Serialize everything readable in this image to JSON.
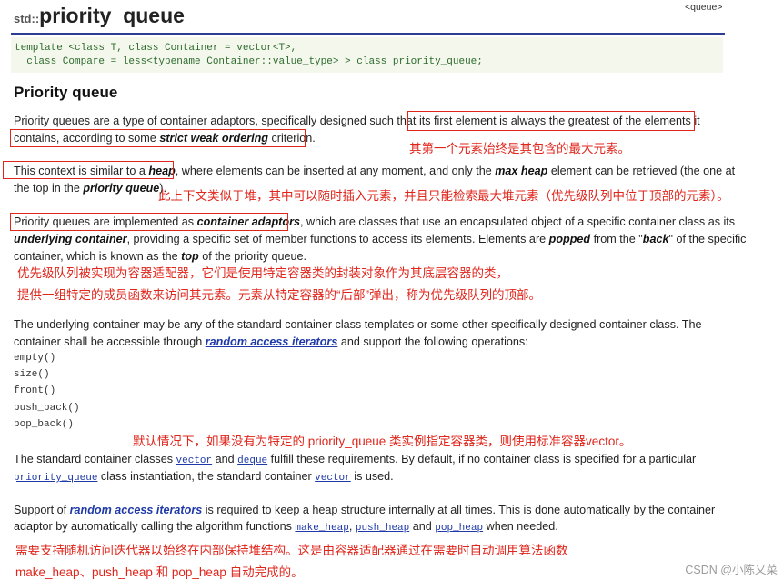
{
  "title": {
    "namespace": "std::",
    "name": "priority_queue"
  },
  "header_tag": "<queue>",
  "declaration": {
    "line1": "template <class T, class Container = vector<T>,",
    "line2": "  class Compare = less<typename Container::value_type> > class priority_queue;"
  },
  "heading": "Priority queue",
  "p1": {
    "l1_a": "Priority queues are a type of container adaptors, specifically designed such that ",
    "l1_b": "its first element is always the greatest of the elements it",
    "l2_a": "contains, according to some ",
    "l2_b": "strict weak ordering",
    "l2_c": " criterion."
  },
  "ann1": "其第一个元素始终是其包含的最大元素。",
  "p2": {
    "l1_a": "This context is similar to a ",
    "l1_b": "heap",
    "l1_c": ", where elements can be inserted at any moment, and only the ",
    "l1_d": "max heap",
    "l1_e": " element can be retrieved (the one at",
    "l2_a": "the top in the ",
    "l2_b": "priority queue",
    "l2_c": ")."
  },
  "ann2": "此上下文类似于堆，其中可以随时插入元素，并且只能检索最大堆元素（优先级队列中位于顶部的元素）。",
  "p3": {
    "l1_a": "Priority queues are implemented as ",
    "l1_b": "container adaptors",
    "l1_c": ", which are classes that use an encapsulated object of a specific container class as its",
    "l2_a": "underlying container",
    "l2_b": ", providing a specific set of member functions to access its elements. Elements are ",
    "l2_c": "popped",
    "l2_d": " from the \"",
    "l2_e": "back",
    "l2_f": "\" of the specific",
    "l3_a": "container, which is known as the ",
    "l3_b": "top",
    "l3_c": " of the priority queue."
  },
  "ann3": {
    "l1": "优先级队列被实现为容器适配器，它们是使用特定容器类的封装对象作为其底层容器的类，",
    "l2": "提供一组特定的成员函数来访问其元素。元素从特定容器的“后部”弹出，称为优先级队列的顶部。"
  },
  "p4": {
    "l1": "The underlying container may be any of the standard container class templates or some other specifically designed container class. The",
    "l2_a": "container shall be accessible through ",
    "l2_link": "random access iterators",
    "l2_b": " and support the following operations:"
  },
  "operations": [
    "empty()",
    "size()",
    "front()",
    "push_back()",
    "pop_back()"
  ],
  "ann4": "默认情况下，如果没有为特定的 priority_queue 类实例指定容器类，则使用标准容器vector。",
  "p5": {
    "l1_a": "The standard container classes ",
    "l1_vector": "vector",
    "l1_b": " and ",
    "l1_deque": "deque",
    "l1_c": " fulfill these requirements. By default, if no container class is specified for a particular",
    "l2_pq": "priority_queue",
    "l2_a": " class instantiation, the standard container ",
    "l2_vector": "vector",
    "l2_b": " is used."
  },
  "p6": {
    "l1_a": "Support of ",
    "l1_link": "random access iterators",
    "l1_b": " is required to keep a heap structure internally at all times. This is done automatically by the container",
    "l2_a": "adaptor by automatically calling the algorithm functions ",
    "l2_f1": "make_heap",
    "l2_sep1": ", ",
    "l2_f2": "push_heap",
    "l2_and": " and ",
    "l2_f3": "pop_heap",
    "l2_b": " when needed."
  },
  "ann5": {
    "l1": "需要支持随机访问迭代器以始终在内部保持堆结构。这是由容器适配器通过在需要时自动调用算法函数",
    "l2": "make_heap、push_heap 和 pop_heap 自动完成的。"
  },
  "watermark": "CSDN @小陈又菜",
  "colors": {
    "annotation": "#e0251b",
    "link": "#1f3aa8",
    "rule": "#2e3d8f",
    "code_bg": "#f4f7ec"
  }
}
